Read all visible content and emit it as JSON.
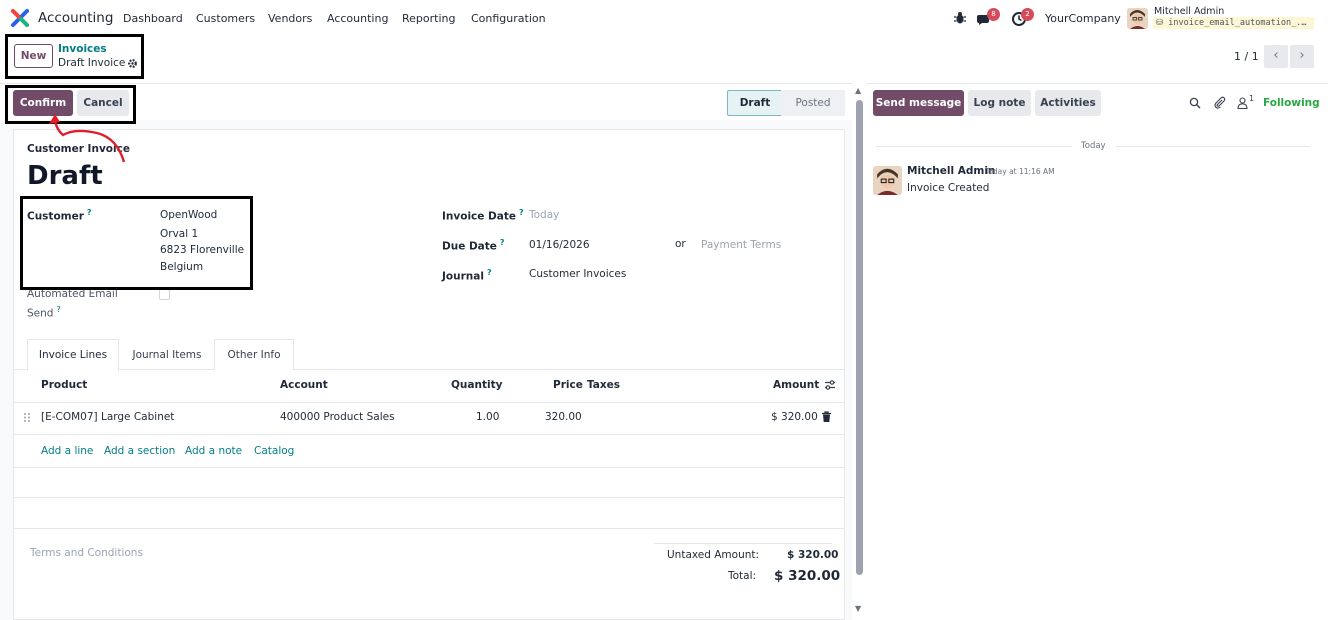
{
  "nav": {
    "app_name": "Accounting",
    "menu": [
      "Dashboard",
      "Customers",
      "Vendors",
      "Accounting",
      "Reporting",
      "Configuration"
    ],
    "messages_badge": "8",
    "activities_badge": "2",
    "company": "YourCompany",
    "user_name": "Mitchell Admin",
    "database": "invoice_email_automation_..."
  },
  "control_panel": {
    "new_label": "New",
    "breadcrumb_parent": "Invoices",
    "breadcrumb_current": "Draft Invoice",
    "pager": "1 / 1"
  },
  "statusbar": {
    "confirm_label": "Confirm",
    "cancel_label": "Cancel",
    "stages": [
      "Draft",
      "Posted"
    ],
    "active_stage": "Draft"
  },
  "form": {
    "type_label": "Customer Invoice",
    "state_title": "Draft",
    "customer_label": "Customer",
    "customer_address": [
      "OpenWood",
      "Orval 1",
      "6823 Florenville",
      "Belgium"
    ],
    "automated_email_label_1": "Automated Email",
    "automated_email_label_2": "Send",
    "automated_email_checked": false,
    "invoice_date_label": "Invoice Date",
    "invoice_date_placeholder": "Today",
    "due_date_label": "Due Date",
    "due_date_value": "01/16/2026",
    "or_label": "or",
    "payment_terms_placeholder": "Payment Terms",
    "journal_label": "Journal",
    "journal_value": "Customer Invoices"
  },
  "tabs": [
    "Invoice Lines",
    "Journal Items",
    "Other Info"
  ],
  "active_tab": "Invoice Lines",
  "lines": {
    "headers": {
      "product": "Product",
      "account": "Account",
      "quantity": "Quantity",
      "price": "Price",
      "taxes": "Taxes",
      "amount": "Amount"
    },
    "rows": [
      {
        "product": "[E-COM07] Large Cabinet",
        "account": "400000 Product Sales",
        "quantity": "1.00",
        "price": "320.00",
        "taxes": "",
        "amount": "$ 320.00"
      }
    ],
    "add_links": [
      "Add a line",
      "Add a section",
      "Add a note",
      "Catalog"
    ]
  },
  "footer": {
    "terms_placeholder": "Terms and Conditions",
    "untaxed_label": "Untaxed Amount:",
    "untaxed_value": "$ 320.00",
    "total_label": "Total:",
    "total_value": "$ 320.00"
  },
  "chatter": {
    "send_message": "Send message",
    "log_note": "Log note",
    "activities": "Activities",
    "followers_count": "1",
    "following": "Following",
    "date_separator": "Today",
    "messages": [
      {
        "author": "Mitchell Admin",
        "time": "Today at 11:16 AM",
        "body": "Invoice Created"
      }
    ]
  },
  "colors": {
    "brand": "#714b67",
    "link": "#017e84",
    "following": "#28a745",
    "badge": "#d44c59"
  }
}
